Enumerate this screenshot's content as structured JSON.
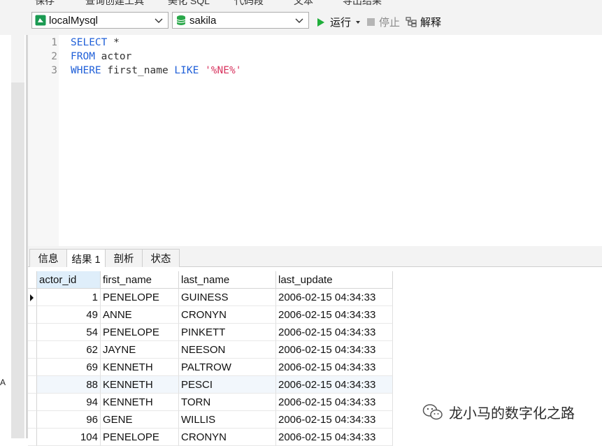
{
  "toolbar": {
    "connection": "localMysql",
    "database": "sakila",
    "run_label": "运行",
    "stop_label": "停止",
    "explain_label": "解释",
    "clipped_items": [
      "保存",
      "查询创建工具",
      "美化 SQL",
      "代码段",
      "文本",
      "导出结果"
    ]
  },
  "editor": {
    "lines": [
      {
        "num": "1",
        "tokens": [
          {
            "t": "SELECT",
            "c": "kw"
          },
          {
            "t": " *",
            "c": "id"
          }
        ]
      },
      {
        "num": "2",
        "tokens": [
          {
            "t": "FROM",
            "c": "kw"
          },
          {
            "t": " actor",
            "c": "id"
          }
        ]
      },
      {
        "num": "3",
        "tokens": [
          {
            "t": "WHERE",
            "c": "kw"
          },
          {
            "t": " first_name ",
            "c": "id"
          },
          {
            "t": "LIKE",
            "c": "kw"
          },
          {
            "t": " ",
            "c": "id"
          },
          {
            "t": "'%NE%'",
            "c": "str"
          }
        ]
      }
    ]
  },
  "tabs": [
    "信息",
    "结果 1",
    "剖析",
    "状态"
  ],
  "active_tab": 1,
  "grid": {
    "columns": [
      "actor_id",
      "first_name",
      "last_name",
      "last_update"
    ],
    "rows": [
      [
        "1",
        "PENELOPE",
        "GUINESS",
        "2006-02-15 04:34:33"
      ],
      [
        "49",
        "ANNE",
        "CRONYN",
        "2006-02-15 04:34:33"
      ],
      [
        "54",
        "PENELOPE",
        "PINKETT",
        "2006-02-15 04:34:33"
      ],
      [
        "62",
        "JAYNE",
        "NEESON",
        "2006-02-15 04:34:33"
      ],
      [
        "69",
        "KENNETH",
        "PALTROW",
        "2006-02-15 04:34:33"
      ],
      [
        "88",
        "KENNETH",
        "PESCI",
        "2006-02-15 04:34:33"
      ],
      [
        "94",
        "KENNETH",
        "TORN",
        "2006-02-15 04:34:33"
      ],
      [
        "96",
        "GENE",
        "WILLIS",
        "2006-02-15 04:34:33"
      ],
      [
        "104",
        "PENELOPE",
        "CRONYN",
        "2006-02-15 04:34:33"
      ]
    ]
  },
  "side_text": "A",
  "watermark": "龙小马的数字化之路",
  "colors": {
    "keyword": "#1f5fd8",
    "string": "#d8345f",
    "run_icon": "#1fae3a",
    "db_icon": "#2aa84a"
  }
}
